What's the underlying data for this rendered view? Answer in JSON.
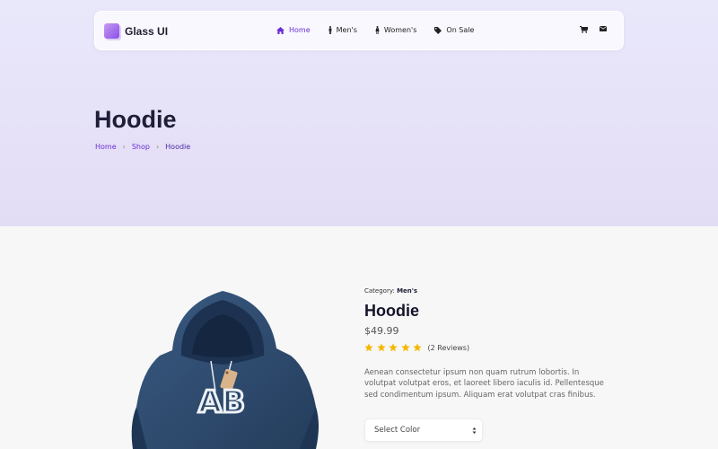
{
  "app": {
    "logo_text": "Glass UI"
  },
  "colors": {
    "accent": "#6b2fd6",
    "hero_top": "#e9e8fb",
    "hero_bottom": "#e3dcf5",
    "star": "#f5b800",
    "hoodie": "#2d4a6e"
  },
  "nav": {
    "items": [
      {
        "label": "Home",
        "icon": "home-icon",
        "active": true
      },
      {
        "label": "Men's",
        "icon": "man-icon"
      },
      {
        "label": "Women's",
        "icon": "woman-icon"
      },
      {
        "label": "On Sale",
        "icon": "tag-icon"
      }
    ],
    "right_icons": [
      "cart-icon",
      "envelope-icon"
    ]
  },
  "hero": {
    "title": "Hoodie",
    "breadcrumb": [
      {
        "label": "Home"
      },
      {
        "label": "Shop"
      },
      {
        "label": "Hoodie"
      }
    ],
    "separator": "›"
  },
  "product": {
    "category_label": "Category: ",
    "category_value": "Men's",
    "title": "Hoodie",
    "price": "$49.99",
    "rating": 5,
    "rating_max": 5,
    "reviews": "(2 Reviews)",
    "description": "Aenean consectetur ipsum non quam rutrum lobortis. In volutpat volutpat eros, et laoreet libero iaculis id. Pellentesque sed condimentum ipsum. Aliquam erat volutpat cras finibus.",
    "image_logo": "AB",
    "select_color": {
      "selected": "Select Color"
    }
  }
}
